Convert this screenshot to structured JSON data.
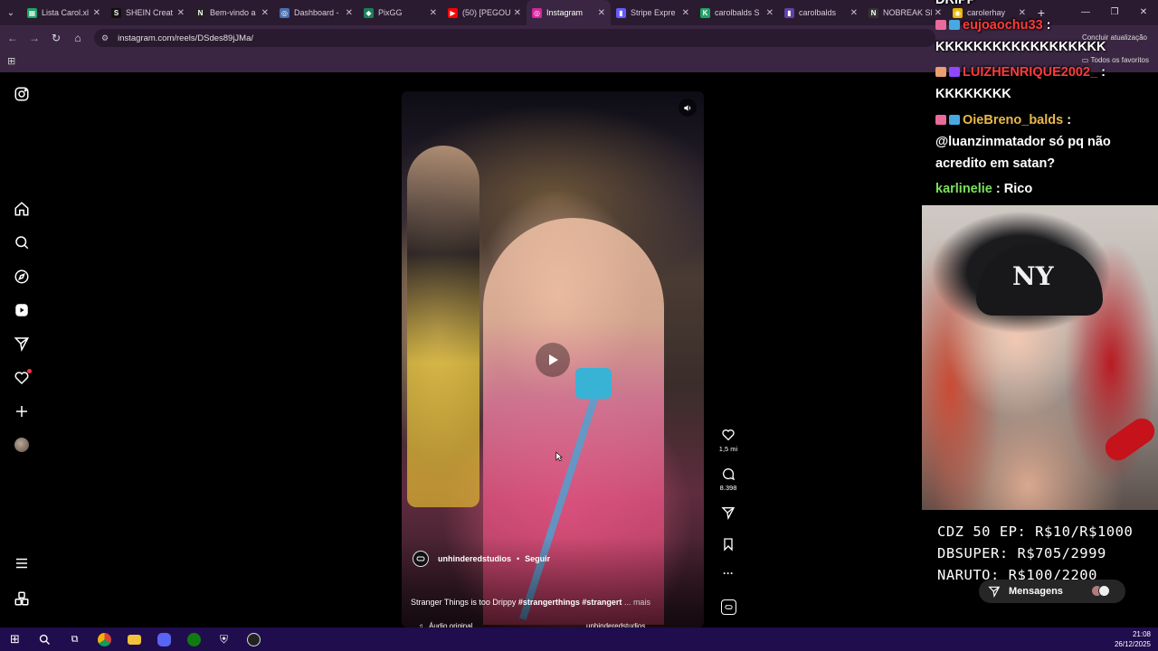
{
  "browser": {
    "tabs": [
      {
        "title": "Lista Carol.xl",
        "fav_color": "#1fa463",
        "fav_glyph": "▦",
        "active": false
      },
      {
        "title": "SHEIN Creat",
        "fav_color": "#111111",
        "fav_glyph": "S",
        "active": false
      },
      {
        "title": "Bem-vindo a",
        "fav_color": "#222222",
        "fav_glyph": "N",
        "active": false
      },
      {
        "title": "Dashboard -",
        "fav_color": "#4a6fb0",
        "fav_glyph": "◎",
        "active": false
      },
      {
        "title": "PixGG",
        "fav_color": "#1a7f5a",
        "fav_glyph": "◆",
        "active": false
      },
      {
        "title": "(50) [PEGOU",
        "fav_color": "#ff0000",
        "fav_glyph": "▶",
        "active": false
      },
      {
        "title": "Instagram",
        "fav_color": "#d6249f",
        "fav_glyph": "◎",
        "active": true
      },
      {
        "title": "Stripe Expre",
        "fav_color": "#635bff",
        "fav_glyph": "▮",
        "active": false
      },
      {
        "title": "carolbalds S",
        "fav_color": "#1fa463",
        "fav_glyph": "K",
        "active": false
      },
      {
        "title": "carolbalds",
        "fav_color": "#6441a5",
        "fav_glyph": "▮",
        "active": false
      },
      {
        "title": "NOBREAK SI",
        "fav_color": "#333333",
        "fav_glyph": "N",
        "active": false
      },
      {
        "title": "carolerhay",
        "fav_color": "#e6b800",
        "fav_glyph": "◉",
        "active": false
      }
    ],
    "url": "instagram.com/reels/DSdes89jJMa/",
    "concluir": "Concluir atualização",
    "all_favorites": "Todos os favoritos"
  },
  "reel": {
    "author": "unhinderedstudios",
    "dot": "•",
    "follow": "Seguir",
    "caption_text": "Stranger Things is too Drippy ",
    "caption_tags": "#strangerthings #strangert",
    "caption_more": "... mais",
    "audio": "Áudio original",
    "audio_user": "unhinderedstudios",
    "likes": "1,5 mi",
    "comments": "8.398"
  },
  "chat": {
    "top_partial": "DRIPP",
    "messages": [
      {
        "user": "eujoaochu33",
        "sep": " :",
        "msg": "KKKKKKKKKKKKKKKKKK",
        "color": "#ff3b3b"
      },
      {
        "user": "LUIZHENRIQUE2002_",
        "sep": " :",
        "msg": "KKKKKKKK",
        "color": "#ff3b3b"
      },
      {
        "user": "OieBreno_balds",
        "sep": " :",
        "msg": "@luanzinmatador só pq não",
        "msg2": "acredito em satan?",
        "color": "#e9b84a"
      },
      {
        "user": "karlinelie",
        "sep": " : ",
        "msg": "Rico",
        "color": "#7be05a"
      }
    ]
  },
  "overlay": {
    "prices": [
      "CDZ 50 EP: R$10/R$1000",
      "DBSUPER: R$705/2999",
      "NARUTO: R$100/2200"
    ],
    "messages_pill": "Mensagens"
  },
  "taskbar": {
    "time": "21:08",
    "date": "26/12/2025"
  }
}
